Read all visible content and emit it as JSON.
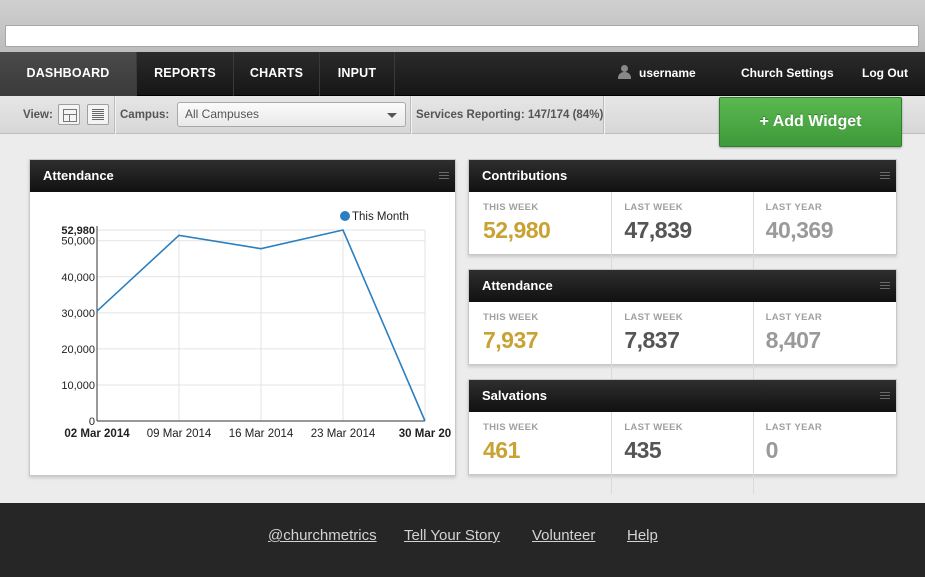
{
  "nav": {
    "tabs": [
      {
        "label": "DASHBOARD",
        "active": true
      },
      {
        "label": "REPORTS",
        "active": false
      },
      {
        "label": "CHARTS",
        "active": false
      },
      {
        "label": "INPUT",
        "active": false
      }
    ],
    "username": "username",
    "church_settings": "Church Settings",
    "logout": "Log Out"
  },
  "toolbar": {
    "view_label": "View:",
    "campus_label": "Campus:",
    "campus_value": "All Campuses",
    "services_reporting": "Services Reporting: 147/174 (84%)",
    "add_widget": "+ Add Widget"
  },
  "attendance_chart": {
    "title": "Attendance"
  },
  "widgets": [
    {
      "title": "Contributions",
      "stats": [
        {
          "label": "THIS WEEK",
          "value": "52,980",
          "color": "#c8a232"
        },
        {
          "label": "LAST WEEK",
          "value": "47,839",
          "color": "#555555"
        },
        {
          "label": "LAST YEAR",
          "value": "40,369",
          "color": "#9a9a9a"
        }
      ]
    },
    {
      "title": "Attendance",
      "stats": [
        {
          "label": "THIS WEEK",
          "value": "7,937",
          "color": "#c8a232"
        },
        {
          "label": "LAST WEEK",
          "value": "7,837",
          "color": "#555555"
        },
        {
          "label": "LAST YEAR",
          "value": "8,407",
          "color": "#9a9a9a"
        }
      ]
    },
    {
      "title": "Salvations",
      "stats": [
        {
          "label": "THIS WEEK",
          "value": "461",
          "color": "#c8a232"
        },
        {
          "label": "LAST WEEK",
          "value": "435",
          "color": "#555555"
        },
        {
          "label": "LAST YEAR",
          "value": "0",
          "color": "#9a9a9a"
        }
      ]
    }
  ],
  "footer": {
    "links": [
      "@churchmetrics",
      "Tell Your Story",
      "Volunteer",
      "Help"
    ]
  },
  "chart_data": {
    "type": "line",
    "categories": [
      "02 Mar 2014",
      "09 Mar 2014",
      "16 Mar 2014",
      "23 Mar 2014",
      "30 Mar 20"
    ],
    "bold_categories": [
      "02 Mar 2014",
      "30 Mar 20"
    ],
    "series": [
      {
        "name": "This Month",
        "values": [
          30500,
          51500,
          47800,
          52980,
          0
        ],
        "color": "#2a7fc0"
      }
    ],
    "y_ticks": [
      "0",
      "10,000",
      "20,000",
      "30,000",
      "40,000",
      "50,000"
    ],
    "y_tick_values": [
      0,
      10000,
      20000,
      30000,
      40000,
      50000
    ],
    "y_max_label": "52,980",
    "y_max_value": 52980,
    "ylim": [
      0,
      52980
    ],
    "grid": true,
    "legend": "top-right"
  }
}
